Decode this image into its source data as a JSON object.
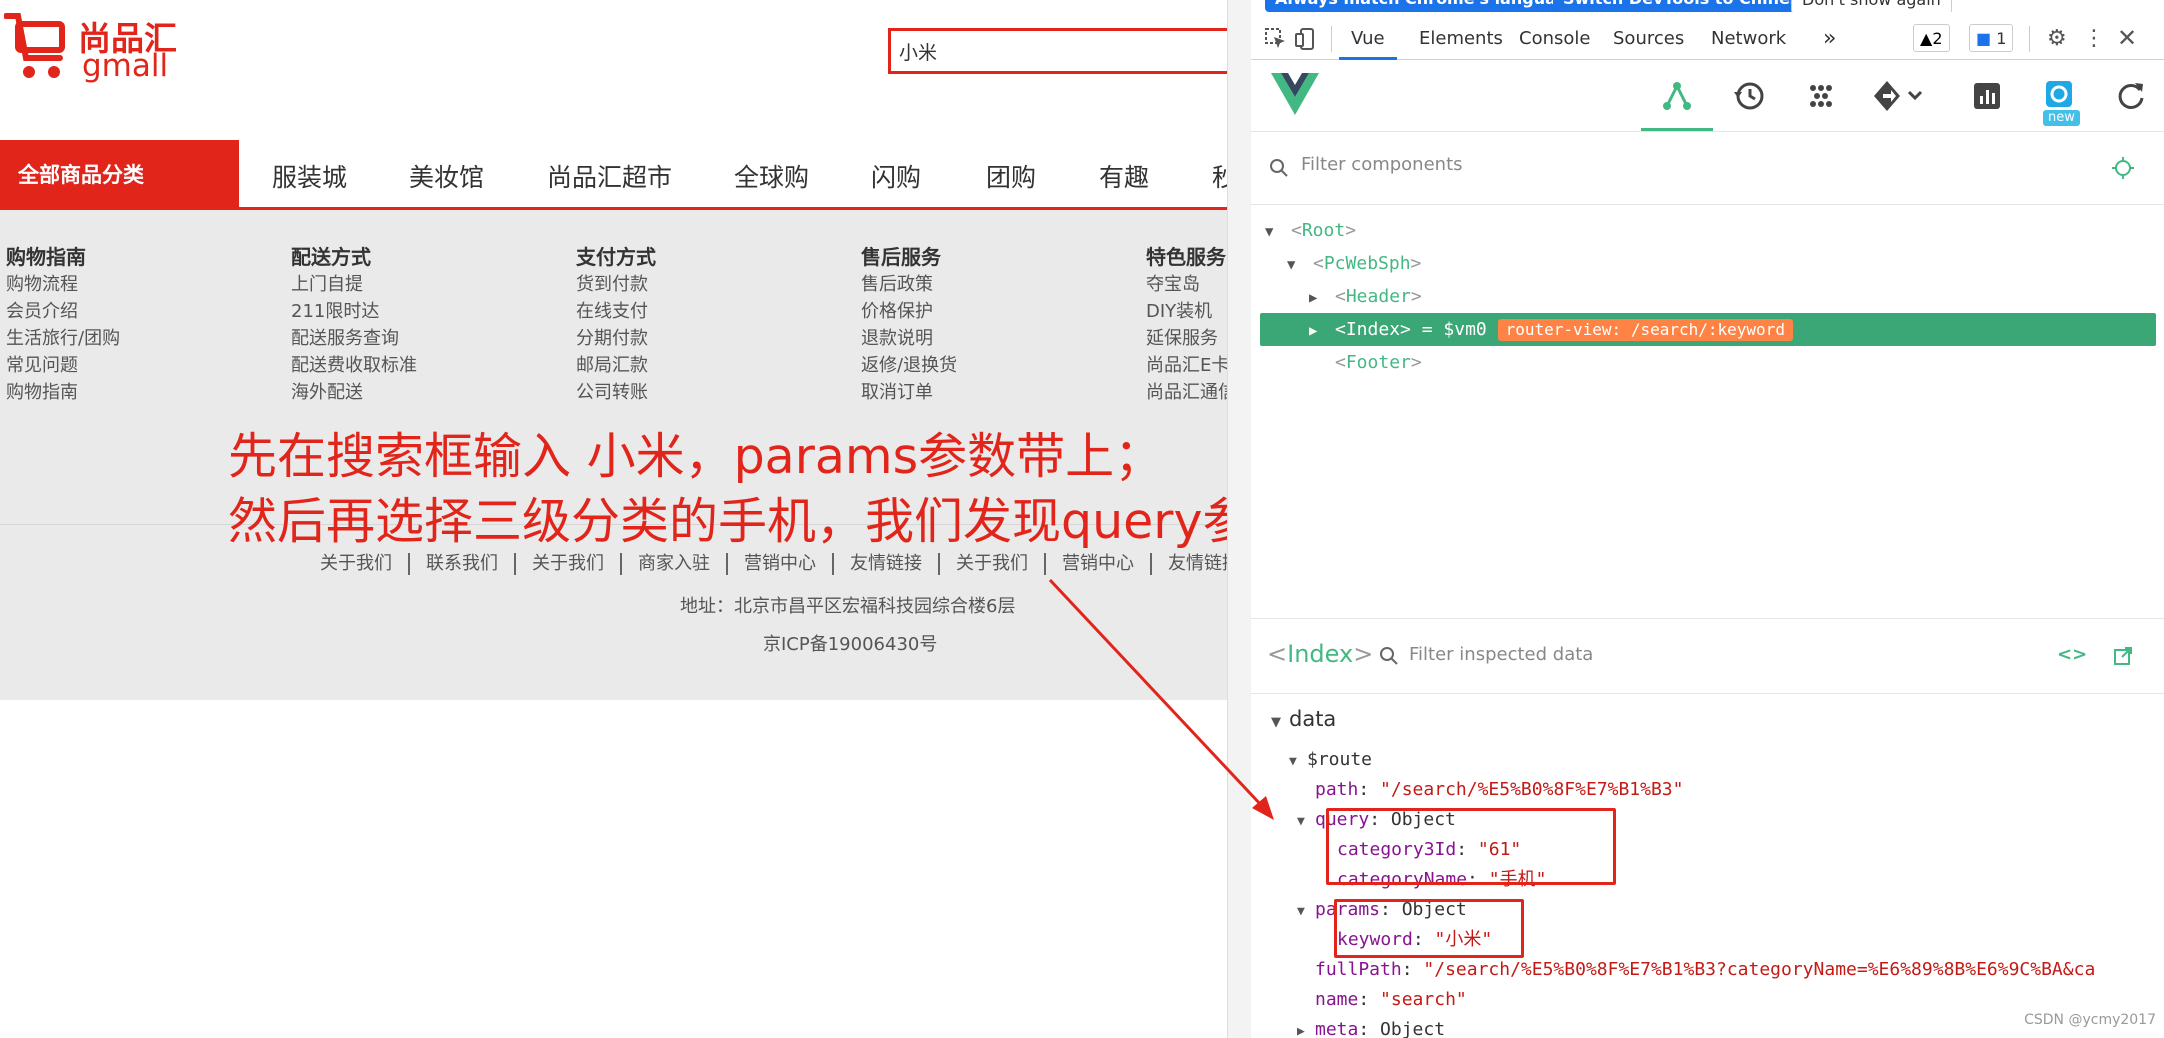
{
  "site": {
    "logo": {
      "line1": "尚品汇",
      "line2": "gmall"
    },
    "search_value": "小米",
    "all_categories": "全部商品分类",
    "nav": [
      "服装城",
      "美妆馆",
      "尚品汇超市",
      "全球购",
      "闪购",
      "团购",
      "有趣",
      "秒"
    ],
    "footer_columns": [
      {
        "title": "购物指南",
        "items": [
          "购物流程",
          "会员介绍",
          "生活旅行/团购",
          "常见问题",
          "购物指南"
        ]
      },
      {
        "title": "配送方式",
        "items": [
          "上门自提",
          "211限时达",
          "配送服务查询",
          "配送费收取标准",
          "海外配送"
        ]
      },
      {
        "title": "支付方式",
        "items": [
          "货到付款",
          "在线支付",
          "分期付款",
          "邮局汇款",
          "公司转账"
        ]
      },
      {
        "title": "售后服务",
        "items": [
          "售后政策",
          "价格保护",
          "退款说明",
          "返修/退换货",
          "取消订单"
        ]
      },
      {
        "title": "特色服务",
        "items": [
          "夺宝岛",
          "DIY装机",
          "延保服务",
          "尚品汇E卡",
          "尚品汇通信"
        ]
      }
    ],
    "footer_links": [
      "关于我们",
      "联系我们",
      "关于我们",
      "商家入驻",
      "营销中心",
      "友情链接",
      "关于我们",
      "营销中心",
      "友情链接"
    ],
    "address": "地址：北京市昌平区宏福科技园综合楼6层",
    "icp": "京ICP备19006430号"
  },
  "annotation": {
    "line1": "先在搜索框输入 小米，params参数带上；",
    "line2": "然后再选择三级分类的手机，我们发现query参数也带上"
  },
  "devtools": {
    "banner": [
      "Always match Chrome's language",
      "Switch DevTools to Chinese",
      "Don't show again"
    ],
    "tabs": [
      "Vue",
      "Elements",
      "Console",
      "Sources",
      "Network"
    ],
    "more_tabs": "»",
    "warnings": "2",
    "messages": "1",
    "new_badge": "new",
    "filter_components_placeholder": "Filter components",
    "tree": {
      "root": "Root",
      "app": "PcWebSph",
      "header": "Header",
      "index": "Index",
      "index_suffix": "= $vm0",
      "router_view": "router-view: /search/:keyword",
      "footer": "Footer"
    },
    "inspector": {
      "component": "Index",
      "filter_placeholder": "Filter inspected data",
      "section": "data",
      "route_key": "$route",
      "path_key": "path",
      "path_val": "\"/search/%E5%B0%8F%E7%B1%B3\"",
      "query_key": "query",
      "object_label": "Object",
      "category3Id_key": "category3Id",
      "category3Id_val": "\"61\"",
      "categoryName_key": "categoryName",
      "categoryName_val": "\"手机\"",
      "params_key": "params",
      "keyword_key": "keyword",
      "keyword_val": "\"小米\"",
      "fullPath_key": "fullPath",
      "fullPath_val": "\"/search/%E5%B0%8F%E7%B1%B3?categoryName=%E6%89%8B%E6%9C%BA&ca",
      "name_key": "name",
      "name_val": "\"search\"",
      "meta_key": "meta"
    }
  },
  "watermark": "CSDN @ycmy2017",
  "colors": {
    "brand_red": "#e1251b",
    "vue_green": "#42b883",
    "selected_row": "#3ba776",
    "router_badge": "#ff8344"
  }
}
